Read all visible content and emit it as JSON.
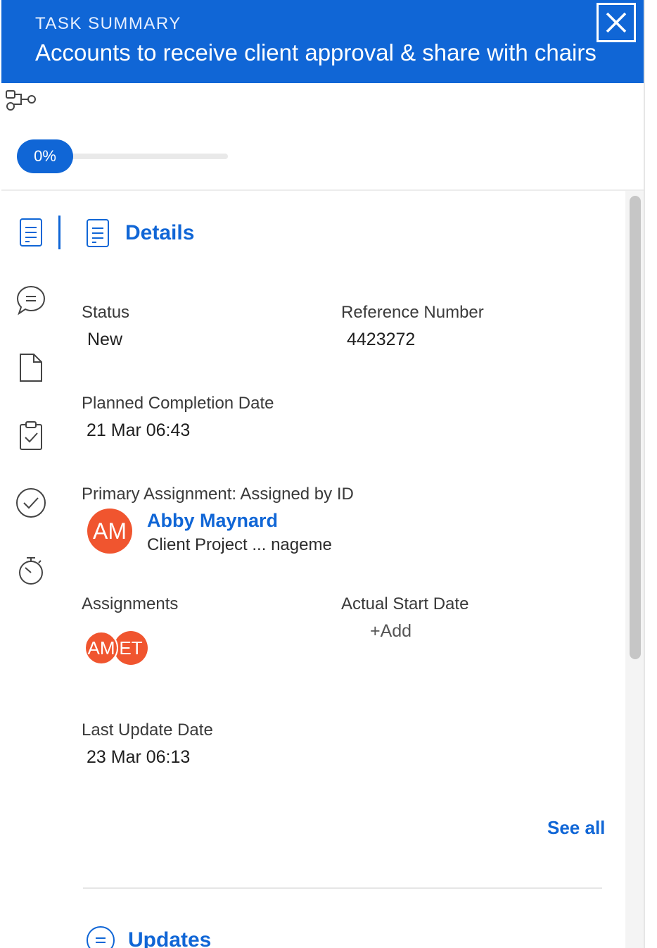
{
  "header": {
    "eyebrow": "TASK SUMMARY",
    "title": "Accounts to receive client approval & share with chairs",
    "close_icon": "close-icon",
    "background_color": "#1066d6"
  },
  "progress": {
    "value_label": "0%",
    "percent": 0
  },
  "sidebar": {
    "items": [
      {
        "name": "details",
        "icon": "document-lines-icon",
        "active": true
      },
      {
        "name": "updates",
        "icon": "comment-icon"
      },
      {
        "name": "documents",
        "icon": "file-icon"
      },
      {
        "name": "approvals",
        "icon": "clipboard-check-icon"
      },
      {
        "name": "completion",
        "icon": "check-circle-icon"
      },
      {
        "name": "time",
        "icon": "stopwatch-icon"
      }
    ]
  },
  "details": {
    "heading": "Details",
    "status": {
      "label": "Status",
      "value": "New"
    },
    "reference": {
      "label": "Reference Number",
      "value": "4423272"
    },
    "planned_completion": {
      "label": "Planned Completion Date",
      "value": "21 Mar 06:43"
    },
    "primary_assignment": {
      "label": "Primary Assignment: Assigned by ID",
      "avatar_initials": "AM",
      "name": "Abby Maynard",
      "role": "Client Project ...  nageme"
    },
    "assignments": {
      "label": "Assignments",
      "avatars": [
        "AM",
        "ET"
      ]
    },
    "actual_start": {
      "label": "Actual Start Date",
      "add_label": "+Add"
    },
    "last_update": {
      "label": "Last Update Date",
      "value": "23 Mar 06:13"
    },
    "see_all": "See all"
  },
  "updates": {
    "heading": "Updates"
  },
  "colors": {
    "accent": "#1066d6",
    "avatar": "#f0552f"
  }
}
